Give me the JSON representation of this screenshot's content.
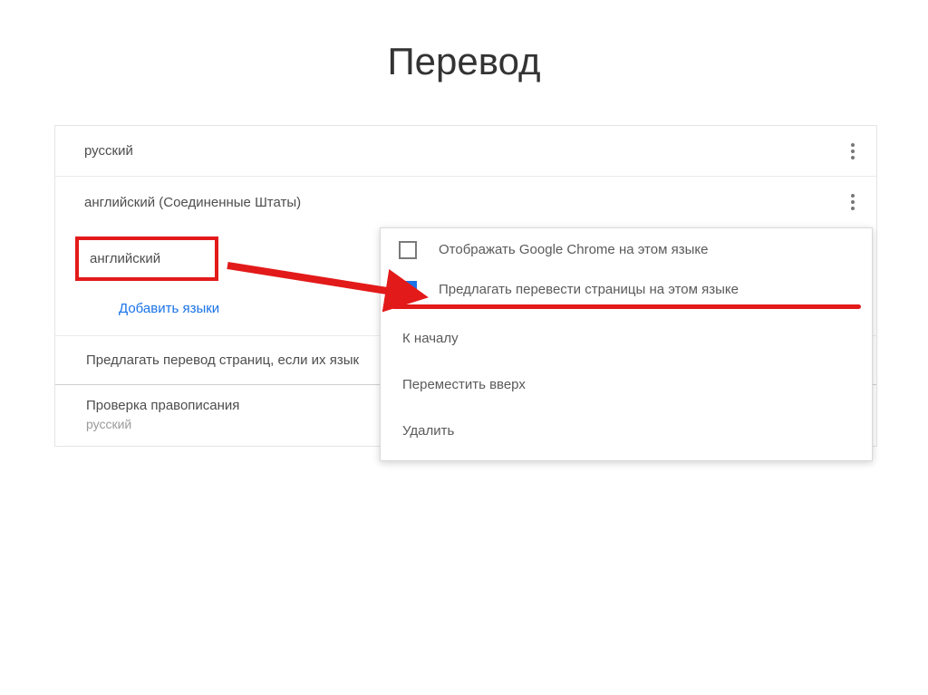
{
  "page_title": "Перевод",
  "languages": {
    "russian": "русский",
    "english_us": "английский (Соединенные Штаты)",
    "english": "английский"
  },
  "add_languages": "Добавить языки",
  "offer_translate_label": "Предлагать перевод страниц, если их язык",
  "spellcheck": {
    "title": "Проверка правописания",
    "language": "русский"
  },
  "popup": {
    "display_chrome": "Отображать Google Chrome на этом языке",
    "offer_translate": "Предлагать перевести страницы на этом языке",
    "to_top": "К началу",
    "move_up": "Переместить вверх",
    "delete": "Удалить"
  },
  "colors": {
    "highlight": "#e31a1a",
    "link": "#1a73e8"
  }
}
